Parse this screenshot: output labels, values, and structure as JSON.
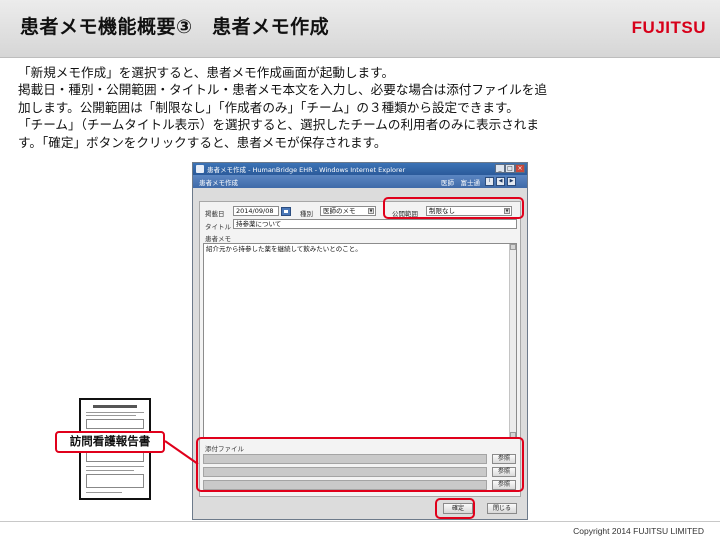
{
  "slide": {
    "title": "患者メモ機能概要③　患者メモ作成",
    "brand": "FUJITSU",
    "copyright": "Copyright 2014 FUJITSU LIMITED"
  },
  "description": [
    "「新規メモ作成」を選択すると、患者メモ作成画面が起動します。",
    "掲載日・種別・公開範囲・タイトル・患者メモ本文を入力し、必要な場合は添付ファイルを追",
    "加します。公開範囲は「制限なし」「作成者のみ」「チーム」の３種類から設定できます。",
    "「チーム」（チームタイトル表示）を選択すると、選択したチームの利用者のみに表示されま",
    "す。「確定」ボタンをクリックすると、患者メモが保存されます。"
  ],
  "window": {
    "title": "患者メモ作成 - HumanBridge EHR - Windows Internet Explorer",
    "app_title": "患者メモ作成",
    "user": "医師　富士通",
    "controls": {
      "minimize": "_",
      "maximize": "□",
      "close": "×"
    }
  },
  "form": {
    "post_date_label": "掲載日",
    "post_date_value": "2014/09/08",
    "type_label": "種別",
    "type_value": "医師のメモ",
    "scope_label": "公開範囲",
    "scope_value": "制限なし",
    "title_label": "タイトル",
    "title_value": "持参薬について",
    "memo_label": "患者メモ",
    "memo_value": "紹介元から持参した薬を継続して飲みたいとのこと。",
    "attach_label": "添付ファイル",
    "ref_button": "参照",
    "confirm_button": "確定",
    "close_button": "閉じる"
  },
  "attachment_doc": {
    "label": "訪問看護報告書"
  },
  "colors": {
    "highlight": "#e0001b",
    "brand": "#d7001a",
    "titlebar": "#2b5a9a"
  }
}
